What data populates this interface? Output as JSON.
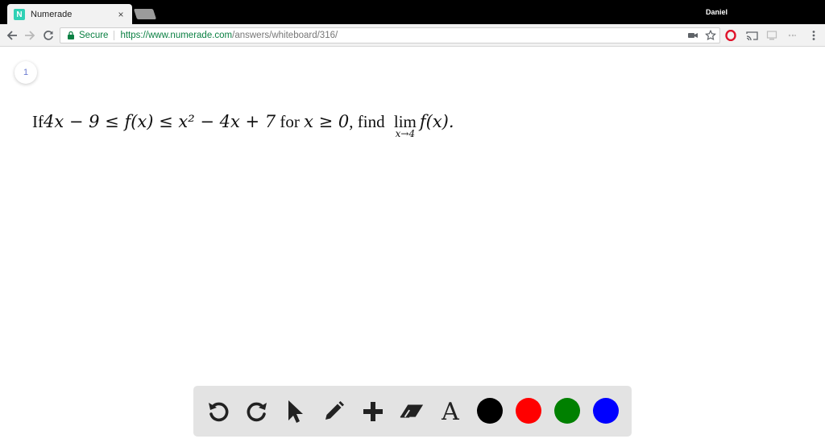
{
  "browser": {
    "tab_title": "Numerade",
    "tab_favicon_letter": "N",
    "tab_close": "×",
    "profile_name": "Daniel",
    "secure_label": "Secure",
    "url_host": "https://www.numerade.com",
    "url_path": "/answers/whiteboard/316/"
  },
  "page": {
    "page_number": "1",
    "question": {
      "prefix": "If ",
      "inequality": "4x − 9 ≤ f(x) ≤ x² − 4x + 7",
      "mid": " for ",
      "condition": "x ≥ 0",
      "find": ", find ",
      "lim": "lim",
      "lim_sub": "x→4",
      "func": "f(x)."
    }
  },
  "draw_toolbar": {
    "tools": [
      "undo-icon",
      "redo-icon",
      "pointer-icon",
      "pencil-icon",
      "plus-icon",
      "eraser-icon",
      "text-icon"
    ],
    "text_tool_glyph": "A",
    "colors": [
      "#000000",
      "#ff0000",
      "#008000",
      "#0000ff"
    ]
  }
}
